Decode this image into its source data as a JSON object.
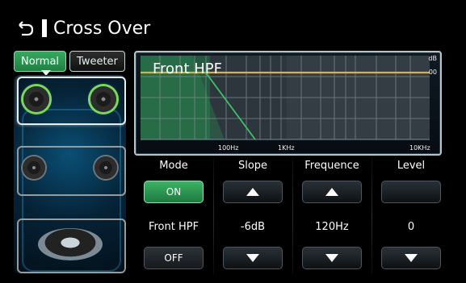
{
  "header": {
    "title": "Cross Over",
    "back_icon": "back-icon"
  },
  "speaker_tabs": {
    "items": [
      {
        "label": "Normal",
        "active": true
      },
      {
        "label": "Tweeter",
        "active": false
      }
    ]
  },
  "graph": {
    "title": "Front HPF",
    "db_unit": "dB",
    "db_zero": "00",
    "freq_labels": [
      "100Hz",
      "1KHz",
      "10KHz"
    ]
  },
  "controls": {
    "mode": {
      "header": "Mode",
      "on_label": "ON",
      "value": "Front HPF",
      "off_label": "OFF"
    },
    "slope": {
      "header": "Slope",
      "value": "-6dB"
    },
    "frequence": {
      "header": "Frequence",
      "value": "120Hz"
    },
    "level": {
      "header": "Level",
      "value": "0"
    }
  },
  "colors": {
    "accent_green": "#33a85f",
    "curve_yellow": "#d4b447",
    "curve_green": "#3fc06c"
  }
}
